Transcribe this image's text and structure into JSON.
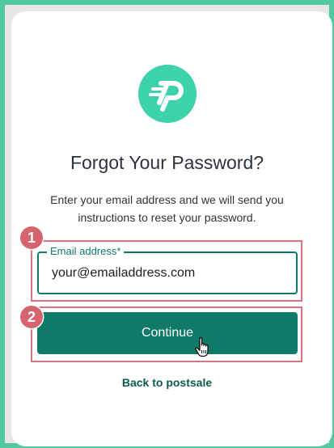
{
  "brand": {
    "logo_icon": "postsale-p-icon",
    "accent_color": "#3cd3aa",
    "primary_color": "#0f7a68"
  },
  "heading": "Forgot Your Password?",
  "description": {
    "line1": "Enter your email address and we will send you",
    "line2": "instructions to reset your password."
  },
  "email_field": {
    "label": "Email address*",
    "value": "your@emailaddress.com"
  },
  "continue_button": {
    "label": "Continue"
  },
  "back_link": {
    "label": "Back to postsale"
  },
  "annotations": {
    "step1": "1",
    "step2": "2",
    "highlight_color": "#d9737f"
  },
  "pointer": {
    "icon": "hand-pointer-icon"
  }
}
